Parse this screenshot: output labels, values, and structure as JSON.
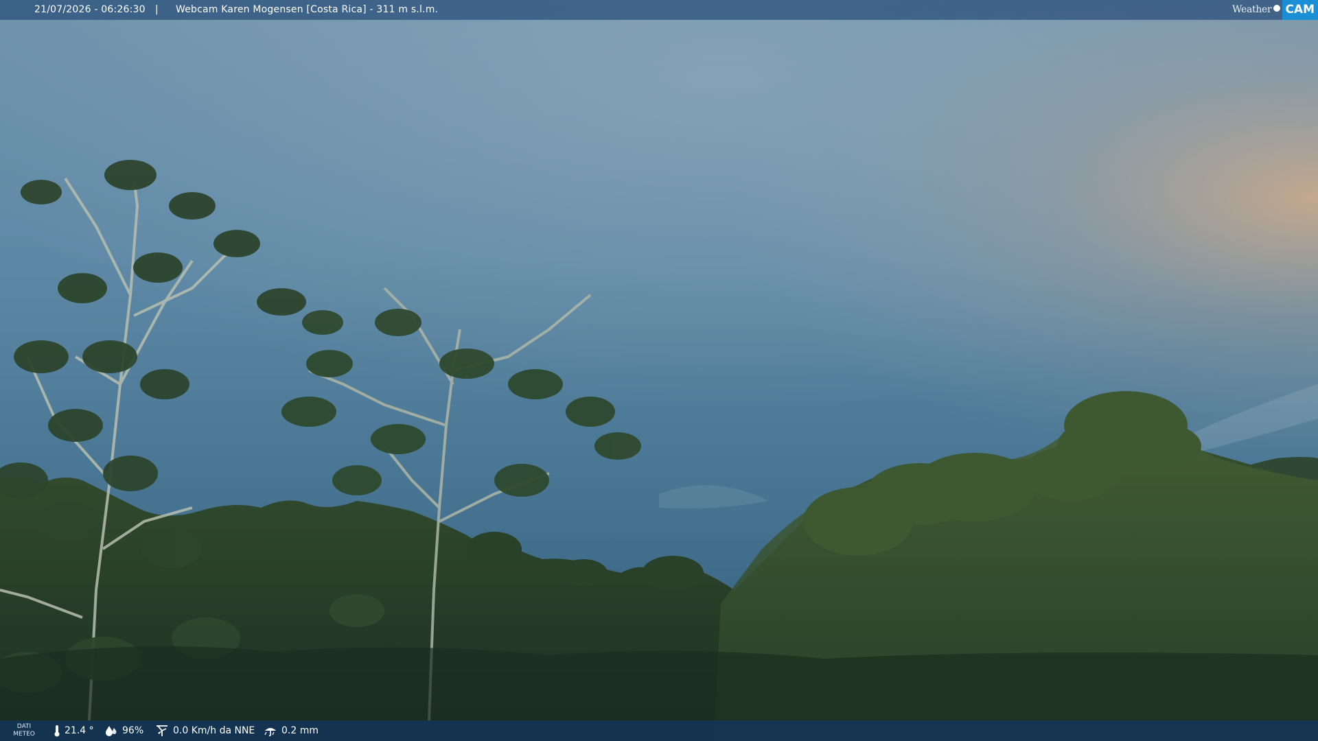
{
  "overlay": {
    "timestamp": "21/07/2026 - 06:26:30",
    "separator": "|",
    "camera_title": "Webcam Karen Mogensen [Costa Rica] - 311 m s.l.m.",
    "brand": {
      "word": "Weather",
      "mark": "CAM"
    }
  },
  "weather": {
    "label_line1": "DATI",
    "label_line2": "METEO",
    "temperature": "21.4 °",
    "humidity": "96%",
    "wind": "0.0 Km/h da NNE",
    "rain": "0.2 mm"
  },
  "icons": {
    "temperature": "thermometer-icon",
    "humidity": "humidity-drop-icon",
    "wind": "wind-vane-icon",
    "rain": "rain-gauge-icon"
  },
  "colors": {
    "sky_top": "#7a9cb6",
    "sky_mid": "#5a86a4",
    "sky_low": "#3d6d8c",
    "dawn_glow": "#c9a583",
    "forest_dark": "#1f3526",
    "forest_mid": "#2f4a30",
    "forest_light": "#40592f",
    "brand_blue": "#1b8fd6"
  }
}
